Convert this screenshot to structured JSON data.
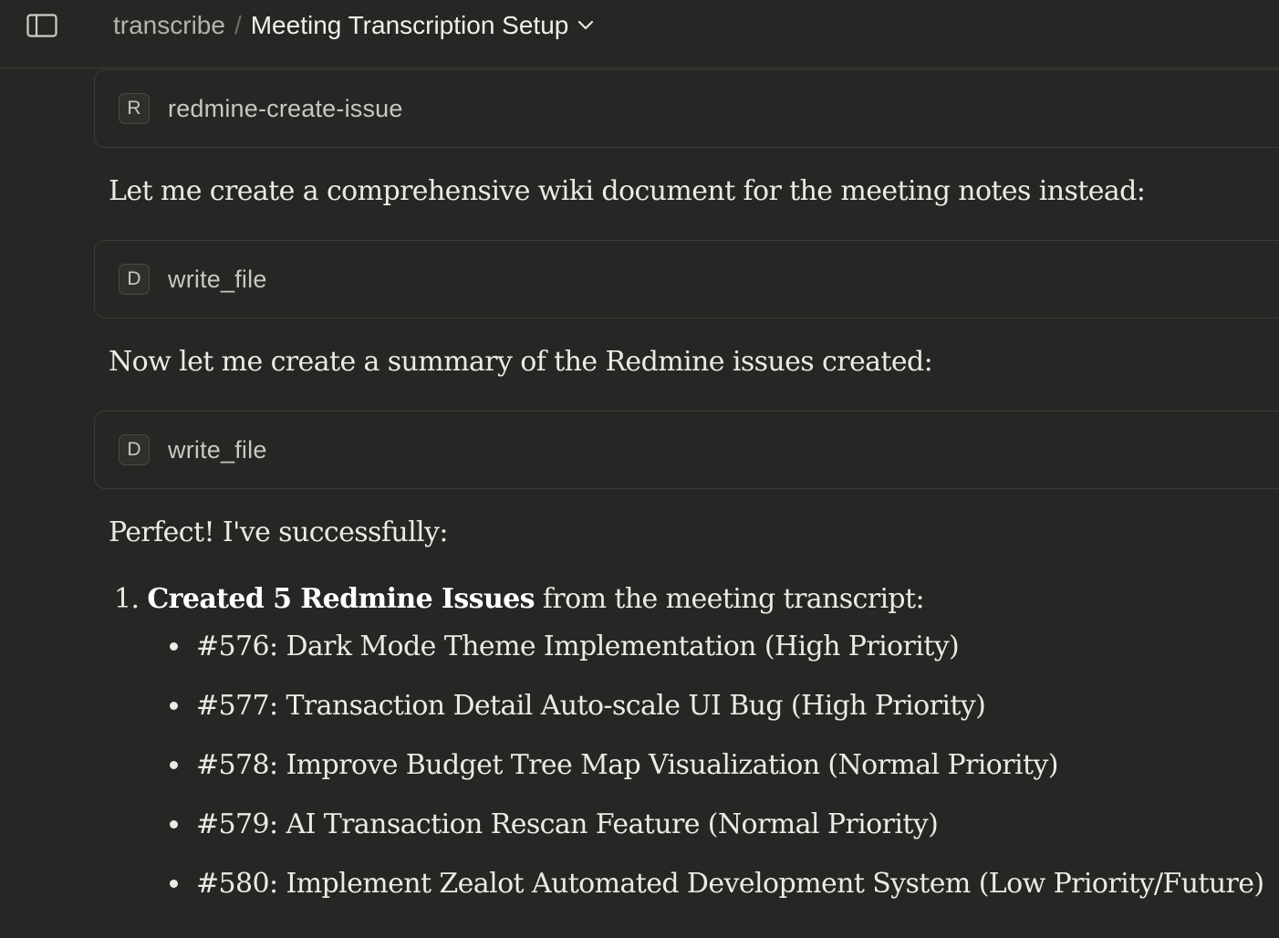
{
  "header": {
    "project": "transcribe",
    "separator": "/",
    "title": "Meeting Transcription Setup"
  },
  "messages": {
    "tool_1": {
      "badge": "R",
      "name": "redmine-create-issue"
    },
    "text_1": "Let me create a comprehensive wiki document for the meeting notes instead:",
    "tool_2": {
      "badge": "D",
      "name": "write_file"
    },
    "text_2": "Now let me create a summary of the Redmine issues created:",
    "tool_3": {
      "badge": "D",
      "name": "write_file"
    },
    "text_3": "Perfect! I've successfully:",
    "list": {
      "number": "1.",
      "bold": "Created 5 Redmine Issues",
      "rest": " from the meeting transcript:",
      "items": [
        "#576: Dark Mode Theme Implementation (High Priority)",
        "#577: Transaction Detail Auto-scale UI Bug (High Priority)",
        "#578: Improve Budget Tree Map Visualization (Normal Priority)",
        "#579: AI Transaction Rescan Feature (Normal Priority)",
        "#580: Implement Zealot Automated Development System (Low Priority/Future)"
      ]
    }
  }
}
